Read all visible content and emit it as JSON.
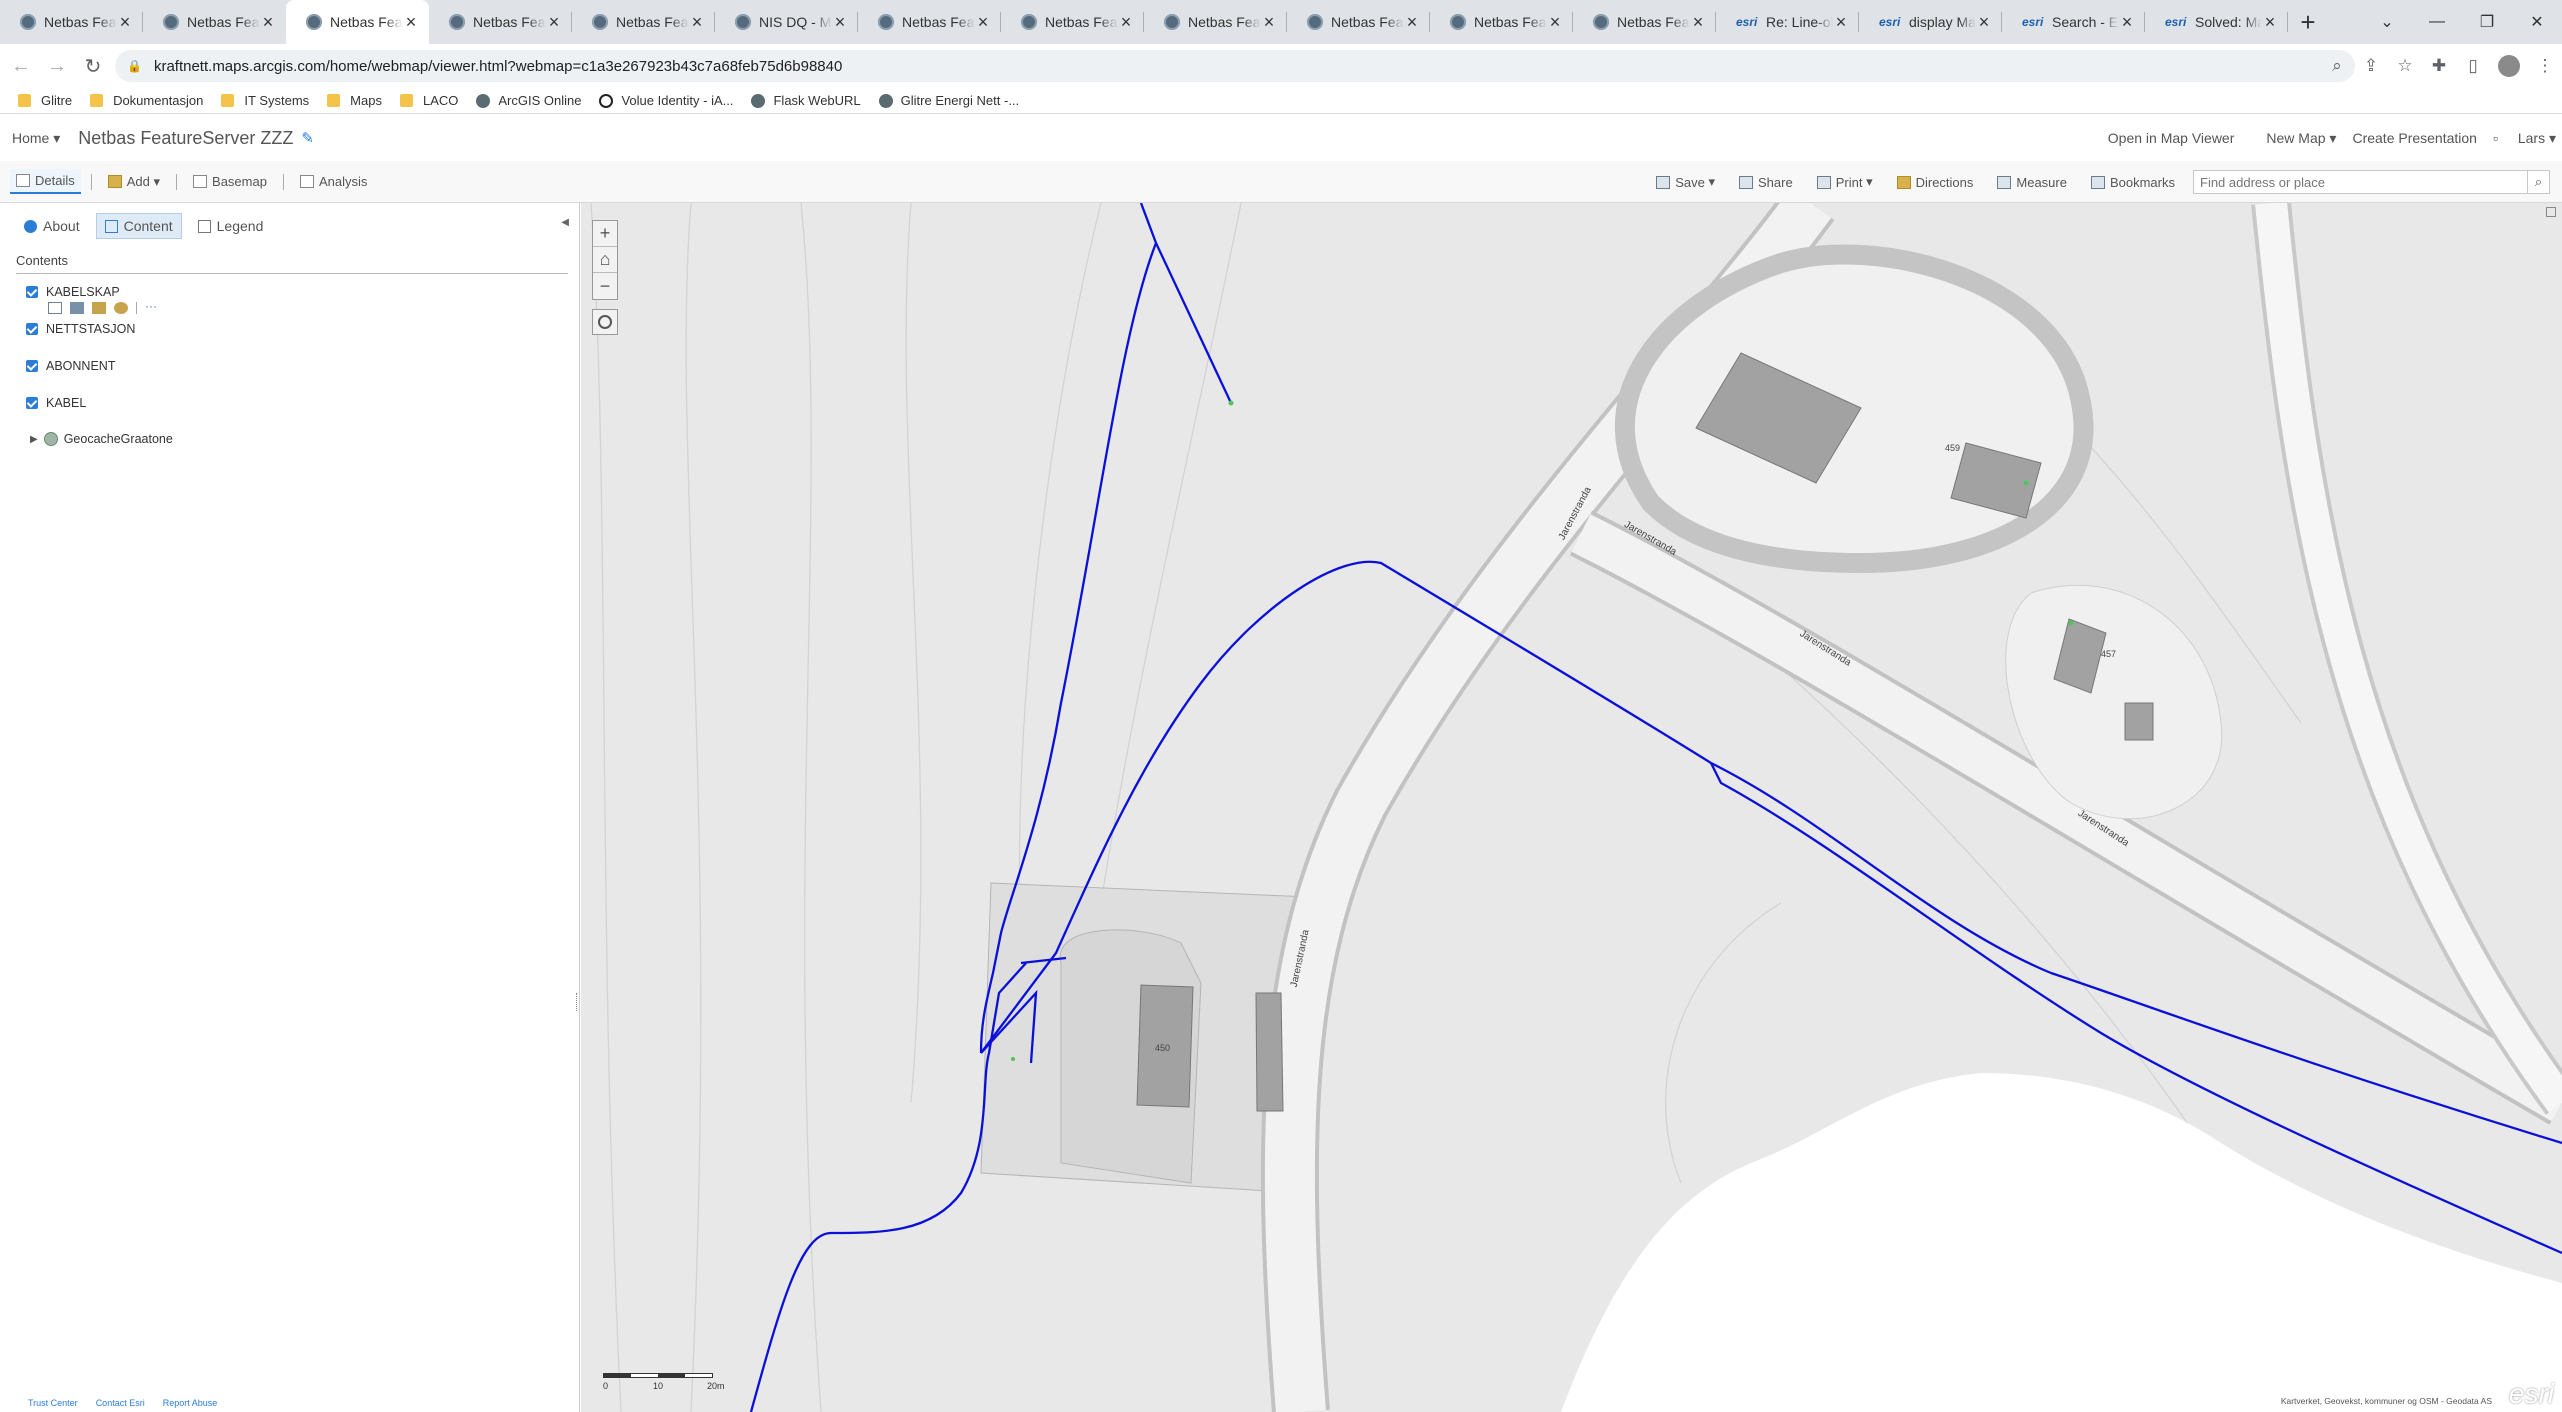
{
  "browser": {
    "tabs": [
      {
        "label": "Netbas FeatureServer",
        "icon": "globe"
      },
      {
        "label": "Netbas FeatureServer",
        "icon": "globe"
      },
      {
        "label": "Netbas FeatureServer",
        "icon": "globe",
        "active": true
      },
      {
        "label": "Netbas FeatureServer",
        "icon": "globe"
      },
      {
        "label": "Netbas FeatureServer",
        "icon": "globe"
      },
      {
        "label": "NIS DQ - Map",
        "icon": "globe"
      },
      {
        "label": "Netbas FeatureServer",
        "icon": "globe"
      },
      {
        "label": "Netbas FeatureServer",
        "icon": "globe"
      },
      {
        "label": "Netbas FeatureServer",
        "icon": "globe"
      },
      {
        "label": "Netbas FeatureServer",
        "icon": "globe"
      },
      {
        "label": "Netbas FeatureServer",
        "icon": "globe"
      },
      {
        "label": "Netbas FeatureServer",
        "icon": "globe"
      },
      {
        "label": "Re: Line-objects",
        "icon": "esri"
      },
      {
        "label": "display Mapviewer",
        "icon": "esri"
      },
      {
        "label": "Search - Esri Community",
        "icon": "esri"
      },
      {
        "label": "Solved: Map Viewer",
        "icon": "esri"
      }
    ],
    "esri_text": "esri",
    "url": "kraftnett.maps.arcgis.com/home/webmap/viewer.html?webmap=c1a3e267923b43c7a68feb75d6b98840",
    "bookmarks": [
      {
        "label": "Glitre",
        "icon": "folder"
      },
      {
        "label": "Dokumentasjon",
        "icon": "folder"
      },
      {
        "label": "IT Systems",
        "icon": "folder"
      },
      {
        "label": "Maps",
        "icon": "folder"
      },
      {
        "label": "LACO",
        "icon": "folder"
      },
      {
        "label": "ArcGIS Online",
        "icon": "globe"
      },
      {
        "label": "Volue Identity - iA...",
        "icon": "ring"
      },
      {
        "label": "Flask WebURL",
        "icon": "globe"
      },
      {
        "label": "Glitre Energi Nett -...",
        "icon": "globe"
      }
    ]
  },
  "header": {
    "home": "Home",
    "title": "Netbas FeatureServer ZZZ",
    "links": [
      "Open in Map Viewer",
      "New Map",
      "Create Presentation",
      "Lars"
    ]
  },
  "toolbar": {
    "left": [
      "Details",
      "Add",
      "Basemap",
      "Analysis"
    ],
    "right": [
      "Save",
      "Share",
      "Print",
      "Directions",
      "Measure",
      "Bookmarks"
    ],
    "search_placeholder": "Find address or place"
  },
  "panel": {
    "tabs": [
      "About",
      "Content",
      "Legend"
    ],
    "contents_heading": "Contents",
    "layers": [
      "KABELSKAP",
      "NETTSTASJON",
      "ABONNENT",
      "KABEL"
    ],
    "basemap_layer": "GeocacheGraatone",
    "footer": [
      "Trust Center",
      "Contact Esri",
      "Report Abuse"
    ]
  },
  "map": {
    "street_labels": [
      "Jarenstranda",
      "Jarenstranda",
      "Jarenstranda",
      "Jarenstranda",
      "Jarenstranda"
    ],
    "building_numbers": [
      "459",
      "457",
      "450"
    ],
    "scale_labels": [
      "0",
      "10",
      "20m"
    ],
    "attribution": "Kartverket, Geovekst, kommuner og OSM - Geodata AS",
    "logo": "esri",
    "colors": {
      "cable": "#0a10d8",
      "background": "#e8e8e8",
      "water": "#ffffff",
      "building": "#a2a2a2"
    }
  }
}
